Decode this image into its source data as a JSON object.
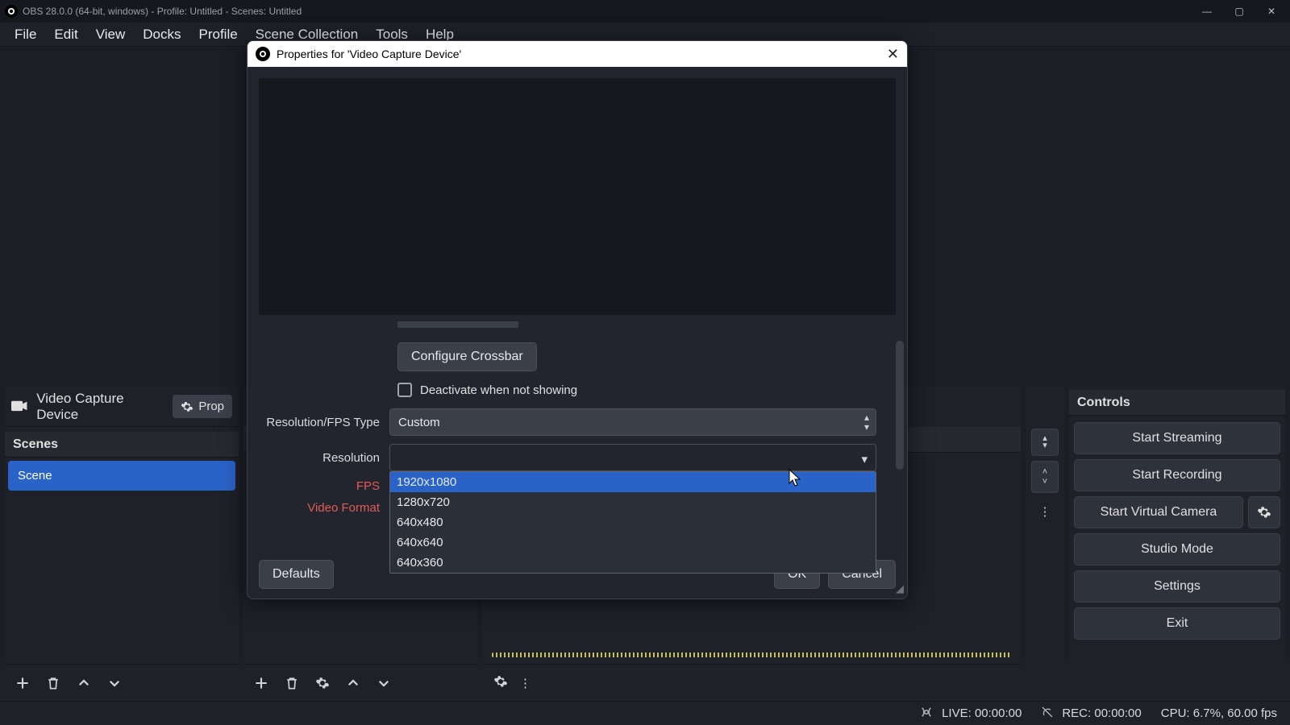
{
  "titlebar": "OBS 28.0.0 (64-bit, windows) - Profile: Untitled - Scenes: Untitled",
  "menu": {
    "file": "File",
    "edit": "Edit",
    "view": "View",
    "docks": "Docks",
    "profile": "Profile",
    "scene_collection": "Scene Collection",
    "tools": "Tools",
    "help": "Help"
  },
  "source_header": {
    "name": "Video Capture Device",
    "prop_btn": "Prop"
  },
  "docks": {
    "scenes_title": "Scenes",
    "controls_title": "Controls",
    "scene_item": "Scene"
  },
  "controls": {
    "start_streaming": "Start Streaming",
    "start_recording": "Start Recording",
    "start_virtual_camera": "Start Virtual Camera",
    "studio_mode": "Studio Mode",
    "settings": "Settings",
    "exit": "Exit"
  },
  "statusbar": {
    "live": "LIVE: 00:00:00",
    "rec": "REC: 00:00:00",
    "cpu": "CPU: 6.7%, 60.00 fps"
  },
  "dialog": {
    "title": "Properties for 'Video Capture Device'",
    "configure_crossbar": "Configure Crossbar",
    "deactivate_label": "Deactivate when not showing",
    "resfps_label": "Resolution/FPS Type",
    "resfps_value": "Custom",
    "resolution_label": "Resolution",
    "fps_label": "FPS",
    "video_format_label": "Video Format",
    "defaults": "Defaults",
    "ok": "OK",
    "cancel": "Cancel",
    "options": [
      "1920x1080",
      "1280x720",
      "640x480",
      "640x640",
      "640x360"
    ]
  }
}
